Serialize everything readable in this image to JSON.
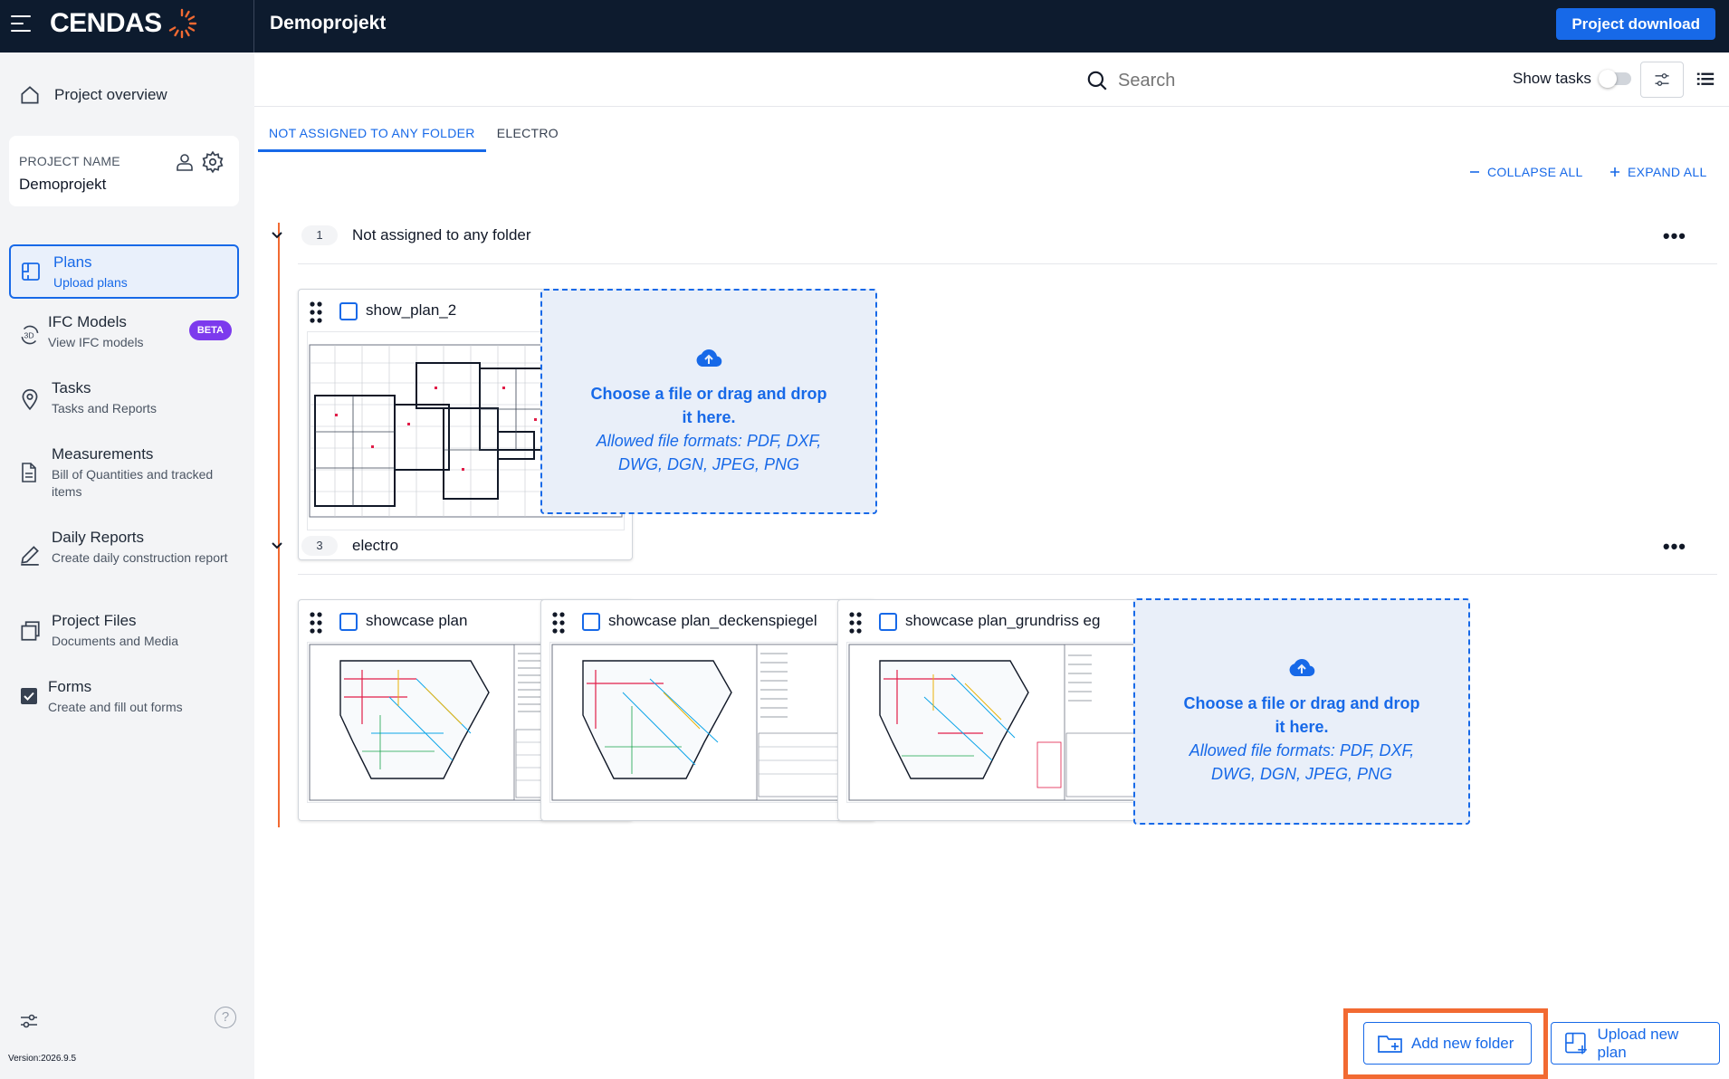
{
  "topbar": {
    "logo_text": "CENDAS",
    "project_title": "Demoprojekt",
    "download_label": "Project download"
  },
  "sidebar": {
    "overview_label": "Project overview",
    "project_card": {
      "label": "PROJECT NAME",
      "value": "Demoprojekt"
    },
    "items": [
      {
        "title": "Plans",
        "subtitle": "Upload plans",
        "icon": "plans-icon",
        "active": true
      },
      {
        "title": "IFC Models",
        "subtitle": "View IFC models",
        "icon": "3d-icon",
        "badge": "BETA"
      },
      {
        "title": "Tasks",
        "subtitle": "Tasks and Reports",
        "icon": "location-pin-icon"
      },
      {
        "title": "Measurements",
        "subtitle": "Bill of Quantities and tracked items",
        "icon": "document-icon"
      },
      {
        "title": "Daily Reports",
        "subtitle": "Create daily construction report",
        "icon": "pen-icon"
      },
      {
        "title": "Project Files",
        "subtitle": "Documents and Media",
        "icon": "files-icon"
      },
      {
        "title": "Forms",
        "subtitle": "Create and fill out forms",
        "icon": "checkbox-icon"
      }
    ],
    "help_glyph": "?",
    "version": "Version:2026.9.5"
  },
  "toolbar": {
    "search_placeholder": "Search",
    "show_tasks_label": "Show tasks",
    "show_tasks_on": false
  },
  "tabs": [
    {
      "label": "NOT ASSIGNED TO ANY FOLDER",
      "active": true
    },
    {
      "label": "ELECTRO",
      "active": false
    }
  ],
  "actions": {
    "collapse_all": "COLLAPSE ALL",
    "expand_all": "EXPAND ALL"
  },
  "groups": [
    {
      "count": "1",
      "title": "Not assigned to any folder",
      "plans": [
        {
          "name": "show_plan_2"
        }
      ]
    },
    {
      "count": "3",
      "title": "electro",
      "plans": [
        {
          "name": "showcase plan",
          "warning": true
        },
        {
          "name": "showcase plan_deckenspiegel"
        },
        {
          "name": "showcase plan_grundriss eg"
        }
      ]
    }
  ],
  "dropzone": {
    "primary": "Choose a file or drag and drop it here.",
    "secondary": "Allowed file formats: PDF, DXF, DWG, DGN, JPEG, PNG"
  },
  "bottom": {
    "add_folder": "Add new folder",
    "upload_plan": "Upload new plan"
  },
  "colors": {
    "primary": "#1769e8",
    "accent": "#f26a32",
    "topbar": "#0d1b2e",
    "beta": "#7c3aed"
  }
}
